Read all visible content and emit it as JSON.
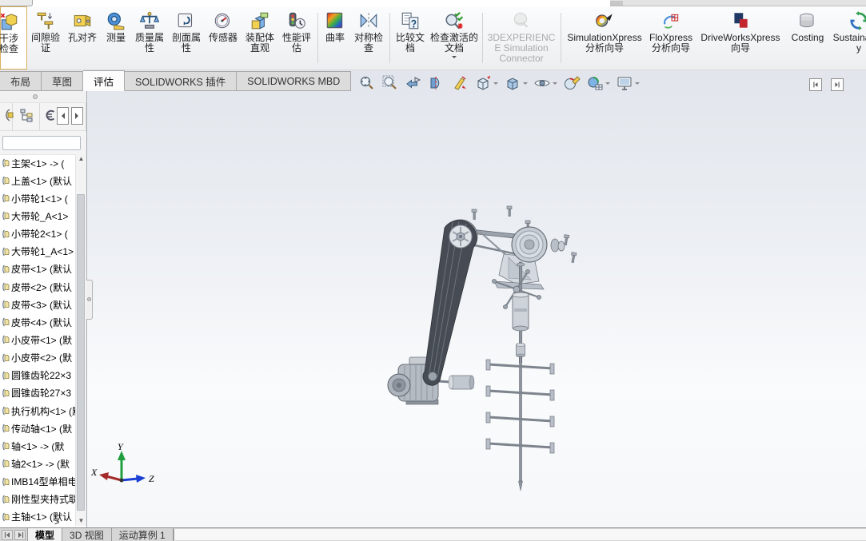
{
  "command_manager": {
    "buttons": [
      {
        "icon": "interference-check-icon",
        "label": "干涉检查",
        "highlighted": true,
        "cut": true
      },
      {
        "icon": "clearance-verification-icon",
        "label": "间隙验证"
      },
      {
        "icon": "hole-alignment-icon",
        "label": "孔对齐"
      },
      {
        "icon": "measure-icon",
        "label": "测量"
      },
      {
        "icon": "mass-properties-icon",
        "label": "质量属性"
      },
      {
        "icon": "section-properties-icon",
        "label": "剖面属性"
      },
      {
        "icon": "sensor-icon",
        "label": "传感器"
      },
      {
        "icon": "assembly-visualization-icon",
        "label": "装配体直观"
      },
      {
        "icon": "performance-evaluation-icon",
        "label": "性能评估",
        "group_end": true
      },
      {
        "icon": "curvature-icon",
        "label": "曲率"
      },
      {
        "icon": "symmetry-check-icon",
        "label": "对称检查",
        "group_end": true
      },
      {
        "icon": "compare-documents-icon",
        "label": "比较文档"
      },
      {
        "icon": "check-active-document-icon",
        "label": "检查激活的文档",
        "dropdown": true,
        "group_end": true
      },
      {
        "icon": "3dexperience-connector-icon",
        "label": "3DEXPERIENCE Simulation Connector",
        "disabled": true,
        "group_end": true
      },
      {
        "icon": "simulationxpress-icon",
        "label": "SimulationXpress 分析向导"
      },
      {
        "icon": "floxpress-icon",
        "label": "FloXpress 分析向导"
      },
      {
        "icon": "driveworksxpress-icon",
        "label": "DriveWorksXpress 向导"
      },
      {
        "icon": "costing-icon",
        "label": "Costing"
      },
      {
        "icon": "sustainability-icon",
        "label": "Sustainability"
      }
    ]
  },
  "ribbon_tabs": [
    {
      "label": "布局"
    },
    {
      "label": "草图"
    },
    {
      "label": "评估",
      "active": true
    },
    {
      "label": "SOLIDWORKS 插件"
    },
    {
      "label": "SOLIDWORKS MBD"
    }
  ],
  "headsup": {
    "items": [
      {
        "icon": "zoom-fit-icon"
      },
      {
        "icon": "zoom-area-icon"
      },
      {
        "icon": "previous-view-icon"
      },
      {
        "icon": "section-view-icon"
      },
      {
        "icon": "annotations-visibility-icon"
      },
      {
        "icon": "view-orientation-icon",
        "dropdown": true
      },
      {
        "icon": "display-style-icon",
        "dropdown": true
      },
      {
        "icon": "hide-show-items-icon",
        "dropdown": true
      },
      {
        "icon": "edit-appearance-icon"
      },
      {
        "icon": "apply-scene-icon",
        "dropdown": true
      },
      {
        "icon": "view-settings-icon",
        "dropdown": true
      }
    ]
  },
  "feature_panel": {
    "filter_value": "",
    "scroll_up": "▲",
    "scroll_down": "▼",
    "scroll_more": ">",
    "items": [
      {
        "icon": "component-icon",
        "label": "主架<1> -> ("
      },
      {
        "icon": "component-icon",
        "label": "上盖<1> (默认"
      },
      {
        "icon": "component-icon",
        "label": "小带轮1<1> ("
      },
      {
        "icon": "component-icon",
        "label": "大带轮_A<1>"
      },
      {
        "icon": "component-icon",
        "label": "小带轮2<1> ("
      },
      {
        "icon": "component-icon",
        "label": "大带轮1_A<1>"
      },
      {
        "icon": "component-icon",
        "label": "皮带<1> (默认"
      },
      {
        "icon": "component-icon",
        "label": "皮带<2> (默认"
      },
      {
        "icon": "component-icon",
        "label": "皮带<3> (默认"
      },
      {
        "icon": "component-icon",
        "label": "皮带<4> (默认"
      },
      {
        "icon": "component-icon",
        "label": "小皮带<1> (默"
      },
      {
        "icon": "component-icon",
        "label": "小皮带<2> (默"
      },
      {
        "icon": "component-icon",
        "label": "圆锥齿轮22×3"
      },
      {
        "icon": "component-icon",
        "label": "圆锥齿轮27×3"
      },
      {
        "icon": "component-icon",
        "label": "执行机构<1> (默"
      },
      {
        "icon": "component-icon",
        "label": "传动轴<1> (默"
      },
      {
        "icon": "component-icon",
        "label": "轴<1> -> (默"
      },
      {
        "icon": "component-icon",
        "label": "轴2<1> -> (默"
      },
      {
        "icon": "component-icon",
        "label": "IMB14型单相电"
      },
      {
        "icon": "component-icon",
        "label": "刚性型夹持式联"
      },
      {
        "icon": "component-icon",
        "label": "主轴<1> (默认"
      }
    ]
  },
  "viewport": {
    "triad": {
      "x_label": "X",
      "y_label": "Y",
      "z_label": "Z",
      "x_color": "#b22222",
      "y_color": "#1f9e3e",
      "z_color": "#1a3fd4"
    }
  },
  "bottom_bar": {
    "tabs": [
      {
        "label": "模型",
        "active": true
      },
      {
        "label": "3D 视图"
      },
      {
        "label": "运动算例 1"
      }
    ]
  }
}
